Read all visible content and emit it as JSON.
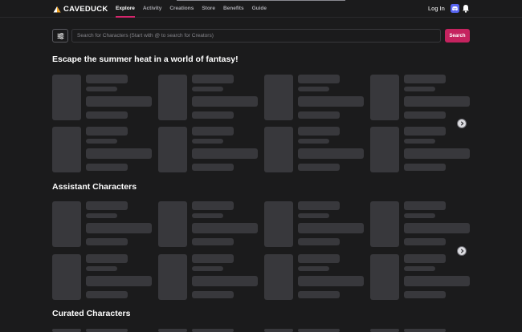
{
  "header": {
    "logo_text": "CAVEDUCK",
    "nav": [
      {
        "label": "Explore",
        "active": true
      },
      {
        "label": "Activity",
        "active": false
      },
      {
        "label": "Creations",
        "active": false
      },
      {
        "label": "Store",
        "active": false
      },
      {
        "label": "Benefits",
        "active": false
      },
      {
        "label": "Guide",
        "active": false
      }
    ],
    "login_label": "Log In"
  },
  "search": {
    "placeholder": "Search for Characters (Start with @ to search for Creators)",
    "value": "",
    "button_label": "Search"
  },
  "sections": [
    {
      "title": "Escape the summer heat in a world of fantasy!"
    },
    {
      "title": "Assistant Characters"
    },
    {
      "title": "Curated Characters"
    }
  ],
  "colors": {
    "accent": "#c5235f",
    "background": "#1b1b1c",
    "skeleton": "#38383c"
  },
  "icons": [
    "duck-logo-icon",
    "filter-sliders-icon",
    "discord-icon",
    "bell-icon",
    "chevron-right-icon"
  ]
}
